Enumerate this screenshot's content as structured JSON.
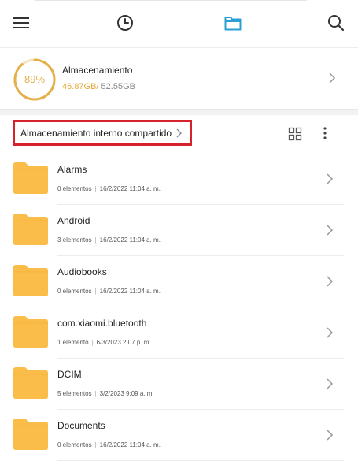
{
  "toolbar": {
    "icons": [
      "menu-icon",
      "clock-icon",
      "folder-icon",
      "search-icon"
    ],
    "accent_color": "#2a9fd6"
  },
  "storage": {
    "percent_label": "89%",
    "percent_value": 89,
    "title": "Almacenamiento",
    "used": "46.87GB",
    "separator": "/",
    "total": " 52.55GB",
    "ring_color": "#e5b04a"
  },
  "path": {
    "label": "Almacenamiento interno compartido",
    "highlight_color": "#d6232b"
  },
  "folders": [
    {
      "name": "Alarms",
      "count": "0 elementos",
      "date": "16/2/2022 11:04 a. m."
    },
    {
      "name": "Android",
      "count": "3 elementos",
      "date": "16/2/2022 11:04 a. m."
    },
    {
      "name": "Audiobooks",
      "count": "0 elementos",
      "date": "16/2/2022 11:04 a. m."
    },
    {
      "name": "com.xiaomi.bluetooth",
      "count": "1 elemento",
      "date": "6/3/2023 2:07 p. m."
    },
    {
      "name": "DCIM",
      "count": "5 elementos",
      "date": "3/2/2023 9:09 a. m."
    },
    {
      "name": "Documents",
      "count": "0 elementos",
      "date": "16/2/2022 11:04 a. m."
    }
  ],
  "folder_color": "#fbbd4a",
  "meta_separator": "|"
}
